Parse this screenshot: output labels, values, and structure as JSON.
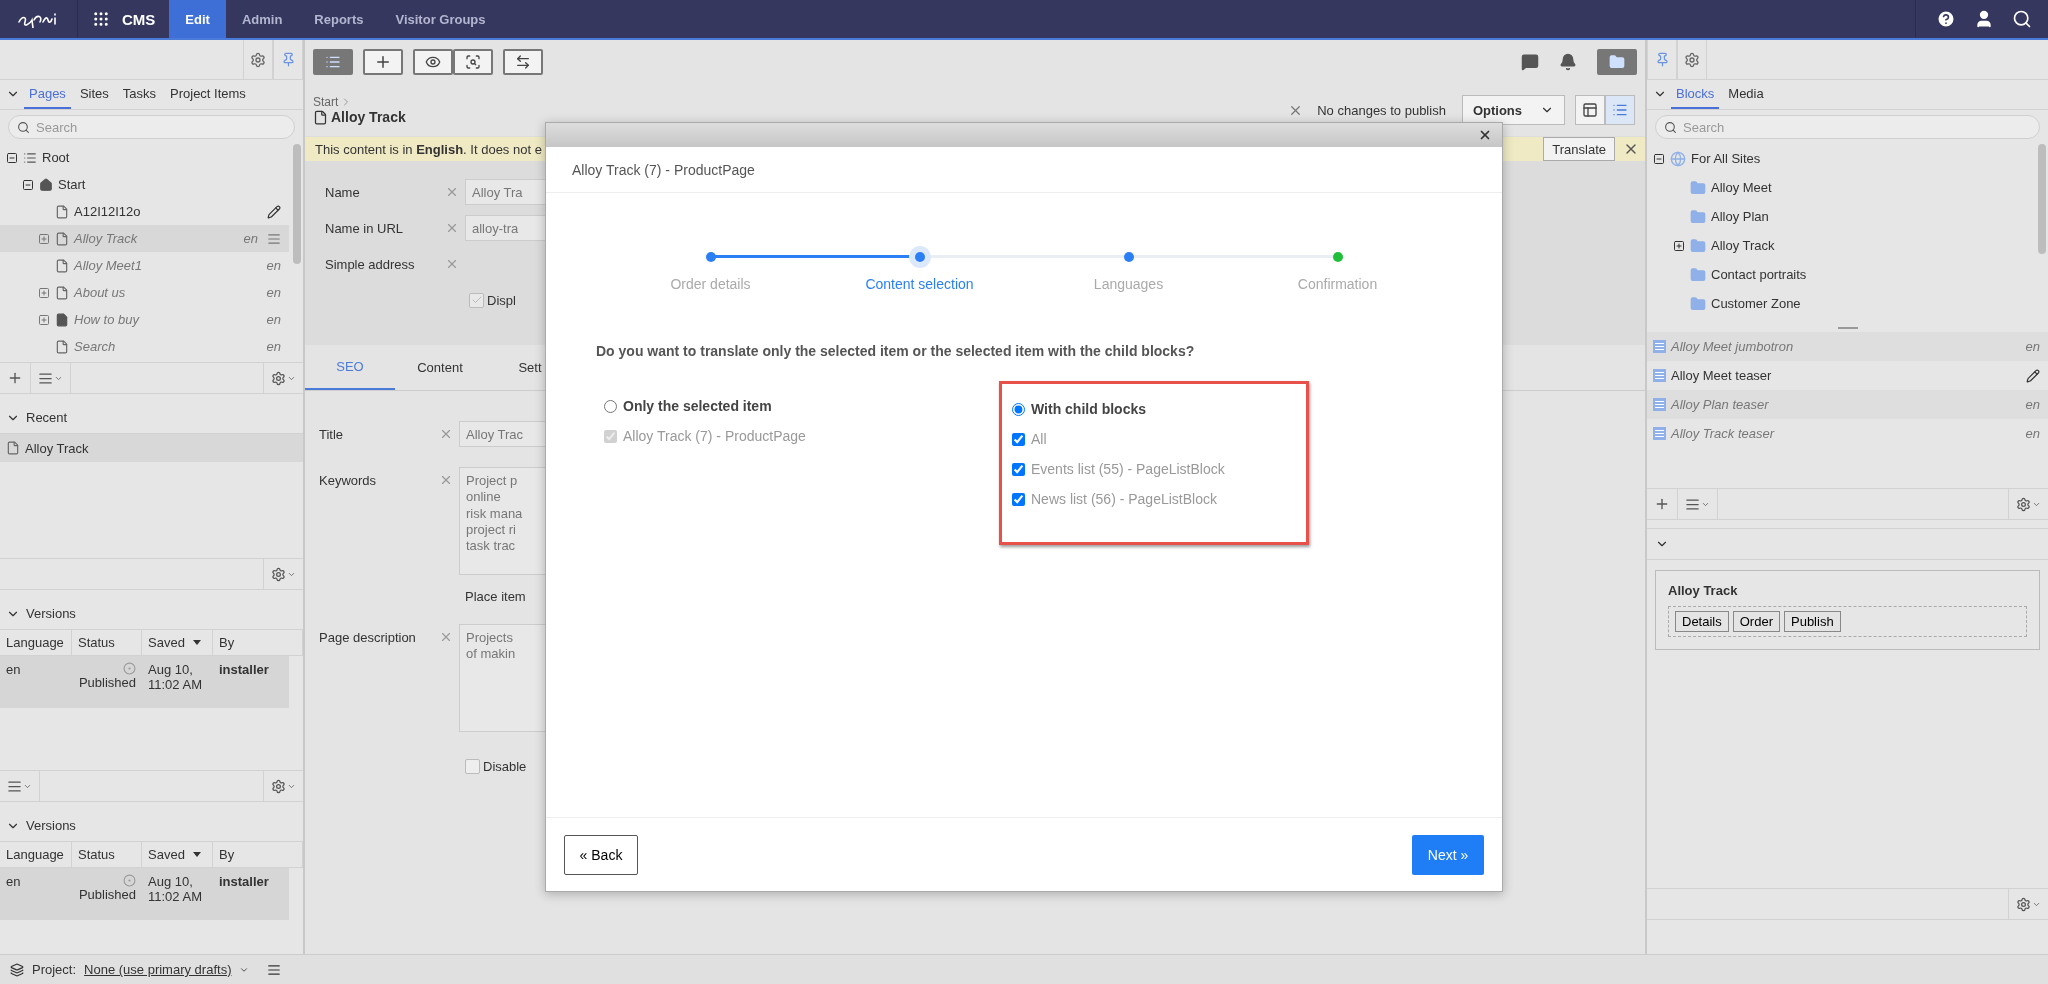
{
  "topbar": {
    "product": "CMS",
    "menu": [
      {
        "label": "Edit",
        "selected": true
      },
      {
        "label": "Admin",
        "selected": false
      },
      {
        "label": "Reports",
        "selected": false
      },
      {
        "label": "Visitor Groups",
        "selected": false
      }
    ]
  },
  "left_panel": {
    "tabs": [
      {
        "label": "Pages",
        "selected": true
      },
      {
        "label": "Sites",
        "selected": false
      },
      {
        "label": "Tasks",
        "selected": false
      },
      {
        "label": "Project Items",
        "selected": false
      }
    ],
    "search": {
      "placeholder": "Search"
    },
    "tree": [
      {
        "label": "Root",
        "kind": "list",
        "expanded": true,
        "selected": false,
        "children": [
          {
            "label": "Start",
            "kind": "home",
            "expanded": true,
            "selected": false,
            "children": [
              {
                "label": "A12I12I12o",
                "kind": "page",
                "selected": false,
                "untranslated": false,
                "editing": true
              },
              {
                "label": "Alloy Track",
                "kind": "page",
                "expanded": false,
                "selected": true,
                "untranslated": true,
                "editing": false,
                "language": "en"
              },
              {
                "label": "Alloy Meet1",
                "kind": "page",
                "selected": false,
                "untranslated": true,
                "editing": false,
                "language": "en"
              },
              {
                "label": "About us",
                "kind": "page",
                "expanded": false,
                "selected": false,
                "untranslated": true,
                "editing": false,
                "language": "en"
              },
              {
                "label": "How to buy",
                "kind": "container",
                "expanded": false,
                "selected": false,
                "untranslated": true,
                "editing": false,
                "language": "en"
              },
              {
                "label": "Search",
                "kind": "page",
                "selected": false,
                "untranslated": true,
                "editing": false,
                "language": "en"
              }
            ]
          }
        ]
      }
    ],
    "recent": {
      "title": "Recent",
      "items": [
        "Alloy Track"
      ]
    },
    "versions": [
      {
        "title": "Versions",
        "columns": [
          "Language",
          "Status",
          "Saved",
          "By"
        ],
        "rows": [
          {
            "language": "en",
            "status": "Published",
            "saved": "Aug 10, 11:02 AM",
            "by": "installer"
          }
        ]
      },
      {
        "title": "Versions",
        "columns": [
          "Language",
          "Status",
          "Saved",
          "By"
        ],
        "rows": [
          {
            "language": "en",
            "status": "Published",
            "saved": "Aug 10, 11:02 AM",
            "by": "installer"
          }
        ]
      }
    ]
  },
  "editor": {
    "breadcrumb": "Start",
    "title": "Alloy Track",
    "publish_status": "No changes to publish",
    "options_button": "Options",
    "notice": "This content is in **English**. It does not e",
    "translate_button": "Translate",
    "fields": [
      {
        "label": "Name",
        "value": "Alloy Tra"
      },
      {
        "label": "Name in URL",
        "value": "alloy-tra"
      },
      {
        "label": "Simple address"
      }
    ],
    "display_checkbox": {
      "label": "Displ",
      "checked": true
    },
    "tabs": [
      {
        "label": "SEO",
        "selected": true
      },
      {
        "label": "Content",
        "selected": false
      },
      {
        "label": "Sett",
        "selected": false
      }
    ],
    "seo_fields": [
      {
        "label": "Title",
        "kind": "input",
        "value": "Alloy Trac"
      },
      {
        "label": "Keywords",
        "kind": "textarea",
        "value": "Project p\nonline\nrisk mana\nproject ri\ntask trac",
        "hint": "Place item"
      },
      {
        "label": "Page description",
        "kind": "textarea",
        "value": "Projects\nof makin"
      }
    ],
    "disable_checkbox": {
      "label": "Disable",
      "checked": false
    }
  },
  "dialog": {
    "title": "Alloy Track (7) - ProductPage",
    "steps": [
      {
        "label": "Order details",
        "selected": false,
        "color": "#2b7ff5"
      },
      {
        "label": "Content selection",
        "selected": true,
        "color": "#2b7ff5"
      },
      {
        "label": "Languages",
        "selected": false,
        "color": "#2b7ff5"
      },
      {
        "label": "Confirmation",
        "selected": false,
        "color": "#1fbf3a"
      }
    ],
    "question": "Do you want to translate only the selected item or the selected item with the child blocks?",
    "options": [
      {
        "label": "Only the selected item",
        "selected": false,
        "items": [
          {
            "label": "Alloy Track (7) - ProductPage",
            "checked": true,
            "disabled": true
          }
        ]
      },
      {
        "label": "With child blocks",
        "selected": true,
        "highlighted": true,
        "items": [
          {
            "label": "All",
            "checked": true,
            "disabled": false
          },
          {
            "label": "Events list (55) - PageListBlock",
            "checked": true,
            "disabled": false
          },
          {
            "label": "News list (56) - PageListBlock",
            "checked": true,
            "disabled": false
          }
        ]
      }
    ],
    "back_button": "« Back",
    "next_button": "Next »"
  },
  "right_panel": {
    "tabs": [
      {
        "label": "Blocks",
        "selected": true
      },
      {
        "label": "Media",
        "selected": false
      }
    ],
    "search": {
      "placeholder": "Search"
    },
    "tree": [
      {
        "label": "For All Sites",
        "kind": "shared",
        "expanded": true,
        "selected": false,
        "children": [
          {
            "label": "Alloy Meet",
            "kind": "folder",
            "selected": false
          },
          {
            "label": "Alloy Plan",
            "kind": "folder",
            "selected": false
          },
          {
            "label": "Alloy Track",
            "kind": "folder",
            "expanded": false,
            "selected": false
          },
          {
            "label": "Contact portraits",
            "kind": "folder",
            "selected": false
          },
          {
            "label": "Customer Zone",
            "kind": "folder",
            "selected": false
          }
        ]
      }
    ],
    "blocks": [
      {
        "label": "Alloy Meet jumbotron",
        "untranslated": true,
        "editing": false,
        "language": "en"
      },
      {
        "label": "Alloy Meet teaser",
        "untranslated": false,
        "editing": true
      },
      {
        "label": "Alloy Plan teaser",
        "untranslated": true,
        "editing": false,
        "language": "en"
      },
      {
        "label": "Alloy Track teaser",
        "untranslated": true,
        "editing": false,
        "language": "en"
      }
    ],
    "card": {
      "title": "Alloy Track",
      "buttons": [
        "Details",
        "Order",
        "Publish"
      ]
    }
  },
  "status_bar": {
    "project_label": "Project:",
    "project": "None (use primary drafts)"
  }
}
